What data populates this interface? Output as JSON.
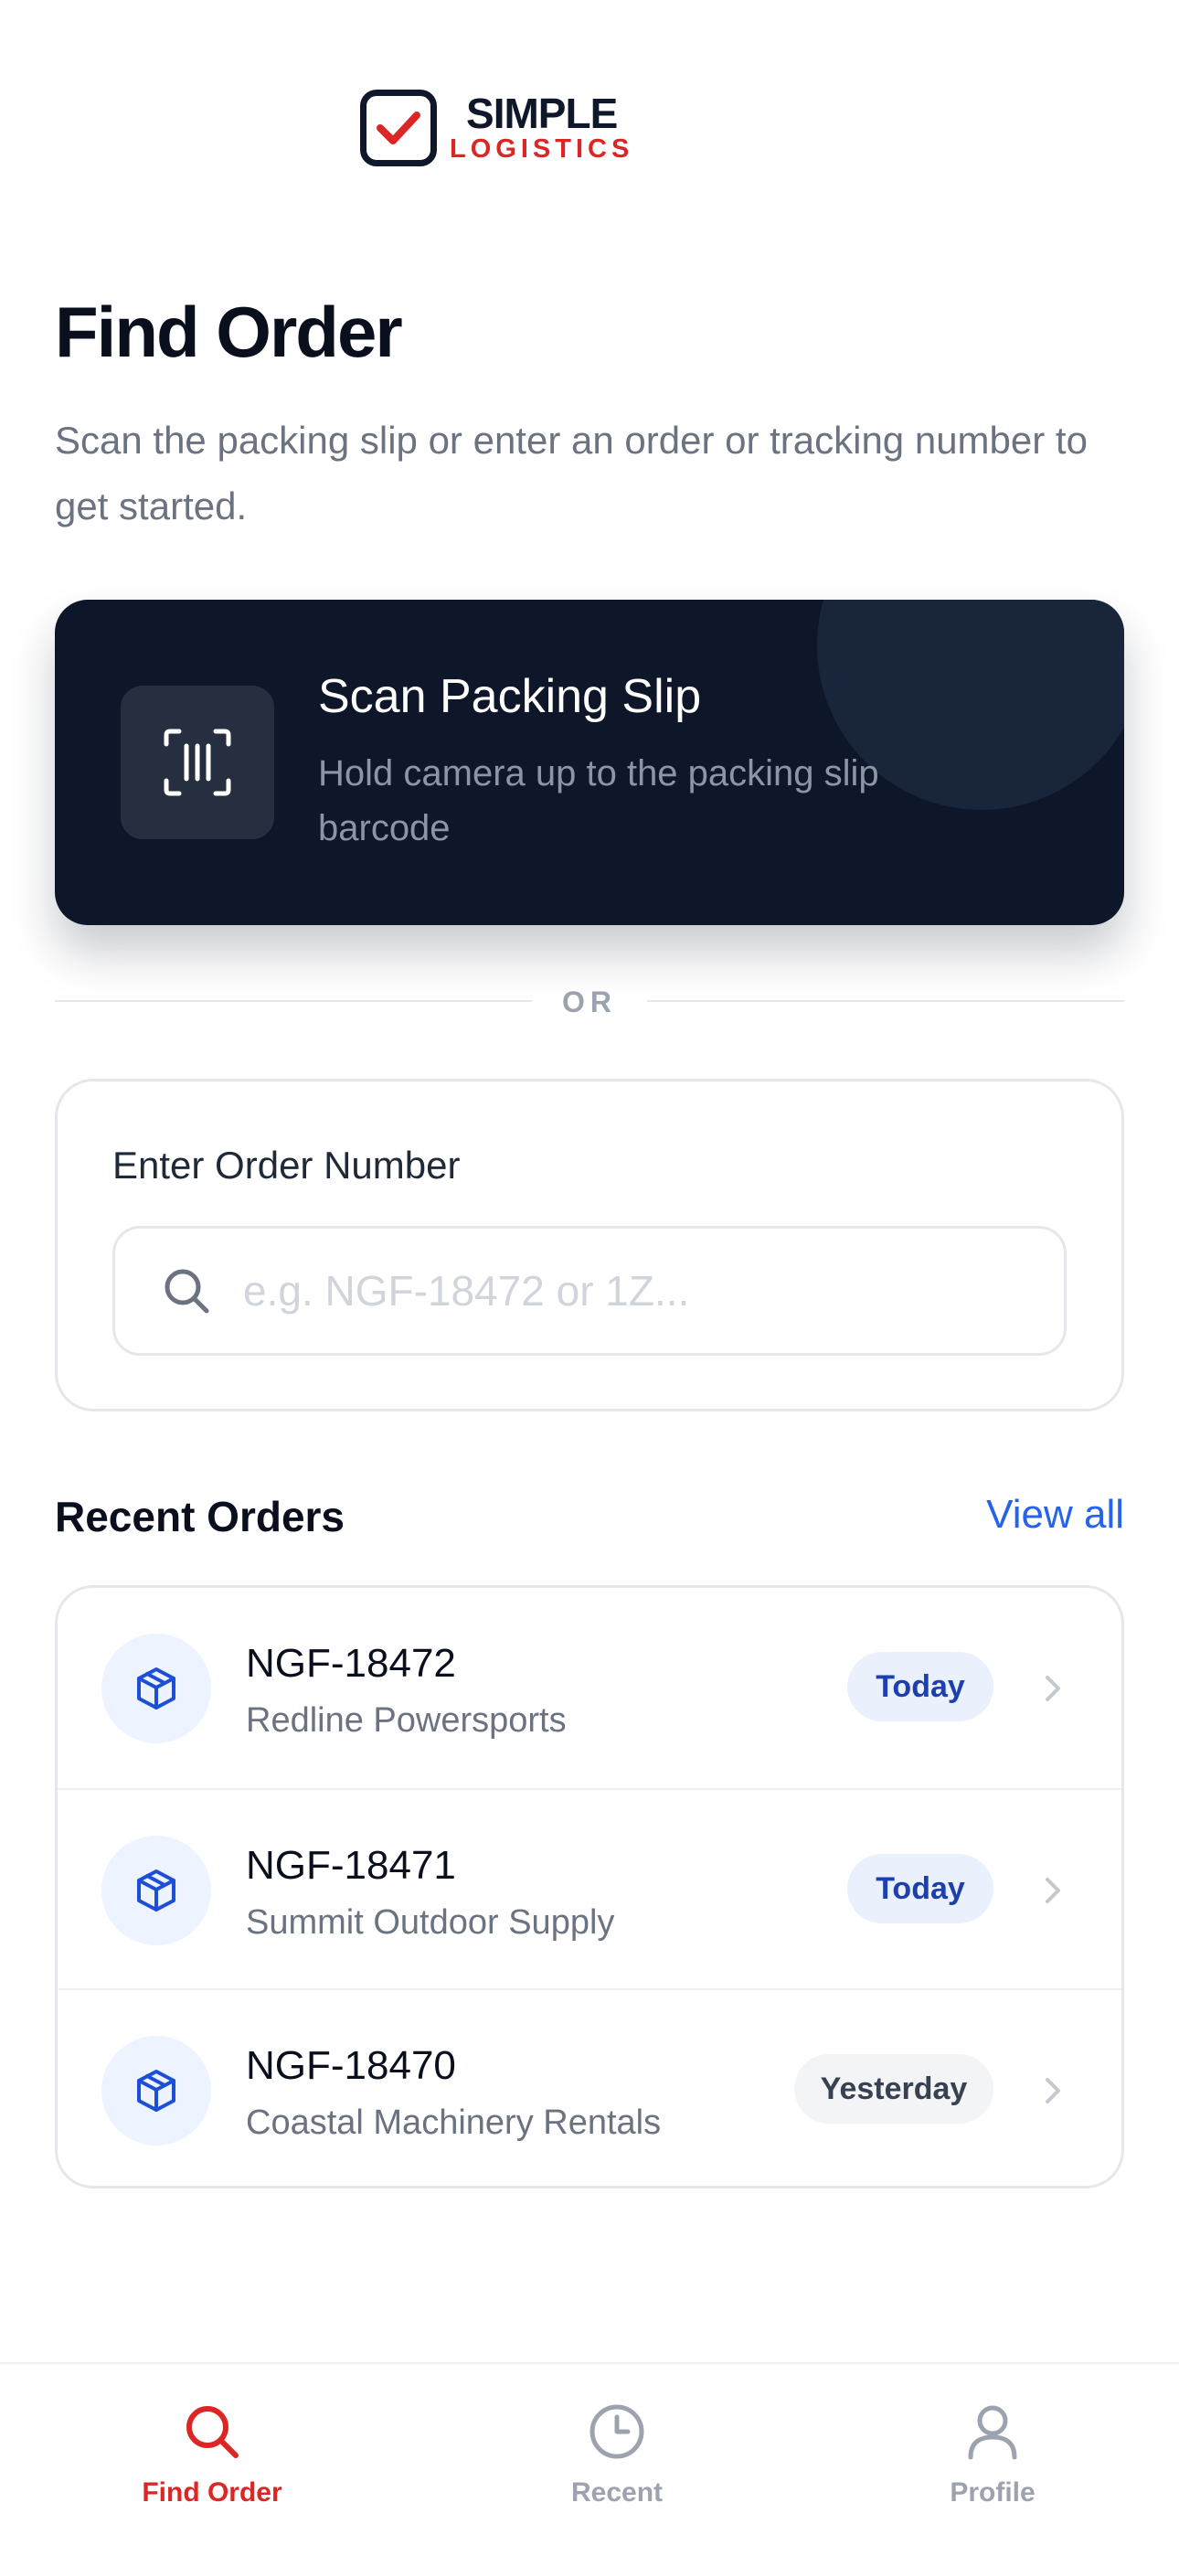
{
  "brand": {
    "line1": "SIMPLE",
    "line2": "LOGISTICS",
    "accent_color": "#dc2626",
    "logo_icon": "checkbox-check-icon"
  },
  "page": {
    "title": "Find Order",
    "subtitle": "Scan the packing slip or enter an order or tracking number to get started."
  },
  "scan": {
    "title": "Scan Packing Slip",
    "description": "Hold camera up to the packing slip barcode",
    "icon": "barcode-scan-icon"
  },
  "divider": {
    "label": "OR"
  },
  "order_input": {
    "label": "Enter Order Number",
    "placeholder": "e.g. NGF-18472 or 1Z...",
    "value": "",
    "icon": "search-icon"
  },
  "recent": {
    "title": "Recent Orders",
    "view_all": "View all",
    "orders": [
      {
        "id": "NGF-18472",
        "customer": "Redline Powersports",
        "when": "Today"
      },
      {
        "id": "NGF-18471",
        "customer": "Summit Outdoor Supply",
        "when": "Today"
      },
      {
        "id": "NGF-18470",
        "customer": "Coastal Machinery Rentals",
        "when": "Yesterday"
      }
    ]
  },
  "nav": {
    "items": [
      {
        "label": "Find Order",
        "icon": "search-icon",
        "active": true
      },
      {
        "label": "Recent",
        "icon": "clock-icon",
        "active": false
      },
      {
        "label": "Profile",
        "icon": "user-icon",
        "active": false
      }
    ]
  },
  "colors": {
    "primary_dark": "#0e1629",
    "link_blue": "#2563eb",
    "muted": "#6b7280"
  }
}
